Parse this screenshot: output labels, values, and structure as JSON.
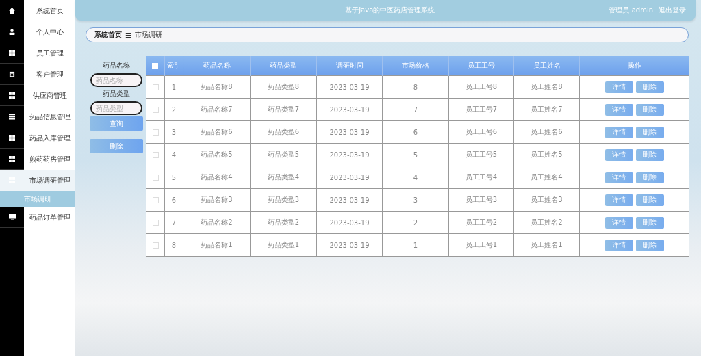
{
  "header": {
    "title": "基于Java的中医药店管理系统",
    "user": "管理员 admin",
    "logout": "退出登录"
  },
  "sidebar": {
    "items": [
      {
        "label": "系统首页",
        "kind": "home",
        "expanded": false
      },
      {
        "label": "个人中心",
        "kind": "user",
        "expanded": false
      },
      {
        "label": "员工管理",
        "kind": "grid",
        "expanded": false
      },
      {
        "label": "客户管理",
        "kind": "clipboard",
        "expanded": false
      },
      {
        "label": "供应商管理",
        "kind": "grid",
        "expanded": false
      },
      {
        "label": "药品信息管理",
        "kind": "list",
        "expanded": false
      },
      {
        "label": "药品入库管理",
        "kind": "grid",
        "expanded": false
      },
      {
        "label": "煎药药房管理",
        "kind": "grid",
        "expanded": false
      },
      {
        "label": "市场调研管理",
        "kind": "grid",
        "expanded": true,
        "children": [
          {
            "label": "市场调研",
            "selected": true
          }
        ]
      },
      {
        "label": "药品订单管理",
        "kind": "monitor",
        "expanded": false
      }
    ]
  },
  "breadcrumb": {
    "items": [
      "系统首页",
      "市场调研"
    ],
    "separator": "☰"
  },
  "search": {
    "fields": [
      {
        "label": "药品名称",
        "placeholder": "药品名称"
      },
      {
        "label": "药品类型",
        "placeholder": "药品类型"
      }
    ],
    "buttons": [
      "查询",
      "删除"
    ]
  },
  "table": {
    "select_all_checked": false,
    "columns": [
      "索引",
      "药品名称",
      "药品类型",
      "调研时间",
      "市场价格",
      "员工工号",
      "员工姓名",
      "操作"
    ],
    "rows": [
      {
        "checked": false,
        "cells": [
          "1",
          "药品名称8",
          "药品类型8",
          "2023-03-19",
          "8",
          "员工工号8",
          "员工姓名8"
        ],
        "actions": [
          "详情",
          "删除"
        ]
      },
      {
        "checked": false,
        "cells": [
          "2",
          "药品名称7",
          "药品类型7",
          "2023-03-19",
          "7",
          "员工工号7",
          "员工姓名7"
        ],
        "actions": [
          "详情",
          "删除"
        ]
      },
      {
        "checked": false,
        "cells": [
          "3",
          "药品名称6",
          "药品类型6",
          "2023-03-19",
          "6",
          "员工工号6",
          "员工姓名6"
        ],
        "actions": [
          "详情",
          "删除"
        ]
      },
      {
        "checked": false,
        "cells": [
          "4",
          "药品名称5",
          "药品类型5",
          "2023-03-19",
          "5",
          "员工工号5",
          "员工姓名5"
        ],
        "actions": [
          "详情",
          "删除"
        ]
      },
      {
        "checked": false,
        "cells": [
          "5",
          "药品名称4",
          "药品类型4",
          "2023-03-19",
          "4",
          "员工工号4",
          "员工姓名4"
        ],
        "actions": [
          "详情",
          "删除"
        ]
      },
      {
        "checked": false,
        "cells": [
          "6",
          "药品名称3",
          "药品类型3",
          "2023-03-19",
          "3",
          "员工工号3",
          "员工姓名3"
        ],
        "actions": [
          "详情",
          "删除"
        ]
      },
      {
        "checked": false,
        "cells": [
          "7",
          "药品名称2",
          "药品类型2",
          "2023-03-19",
          "2",
          "员工工号2",
          "员工姓名2"
        ],
        "actions": [
          "详情",
          "删除"
        ]
      },
      {
        "checked": false,
        "cells": [
          "8",
          "药品名称1",
          "药品类型1",
          "2023-03-19",
          "1",
          "员工工号1",
          "员工姓名1"
        ],
        "actions": [
          "详情",
          "删除"
        ]
      }
    ]
  }
}
